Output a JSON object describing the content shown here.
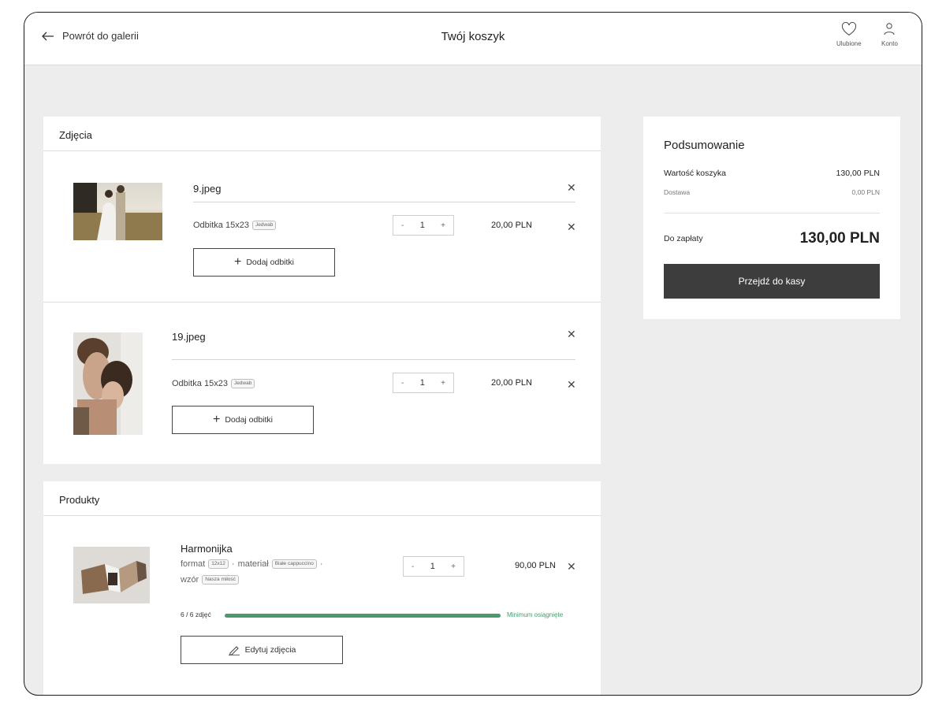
{
  "header": {
    "back_label": "Powrót do galerii",
    "title": "Twój koszyk",
    "favorites_label": "Ulubione",
    "account_label": "Konto"
  },
  "photos_section": {
    "title": "Zdjęcia",
    "items": [
      {
        "filename": "9.jpeg",
        "variant": "Odbitka 15x23",
        "finish": "Jedwab",
        "quantity": "1",
        "price": "20,00 PLN",
        "add_label": "Dodaj odbitki"
      },
      {
        "filename": "19.jpeg",
        "variant": "Odbitka 15x23",
        "finish": "Jedwab",
        "quantity": "1",
        "price": "20,00 PLN",
        "add_label": "Dodaj odbitki"
      }
    ]
  },
  "products_section": {
    "title": "Produkty",
    "items": [
      {
        "name": "Harmonijka",
        "format_label": "format",
        "format_value": "12x12",
        "material_label": "materiał",
        "material_value": "Białe cappuccino",
        "pattern_label": "wzór",
        "pattern_value": "Nasza miłość",
        "quantity": "1",
        "price": "90,00 PLN",
        "photos_count": "6 / 6 zdjęć",
        "progress": 1.0,
        "status": "Minimum osiągnięte",
        "edit_label": "Edytuj zdjęcia"
      }
    ]
  },
  "summary": {
    "title": "Podsumowanie",
    "cart_value_label": "Wartość koszyka",
    "cart_value": "130,00 PLN",
    "delivery_label": "Dostawa",
    "delivery_value": "0,00 PLN",
    "total_label": "Do zapłaty",
    "total_value": "130,00 PLN",
    "checkout_label": "Przejdź do kasy"
  },
  "colors": {
    "progress": "#4a9a6e",
    "status_text": "#4a9a6e",
    "checkout_bg": "#3d3d3d",
    "page_bg": "#ededed"
  },
  "icons": {
    "back": "arrow-left-icon",
    "favorites": "heart-icon",
    "account": "user-icon",
    "remove": "close-icon",
    "add": "plus-icon",
    "edit": "pencil-icon"
  }
}
